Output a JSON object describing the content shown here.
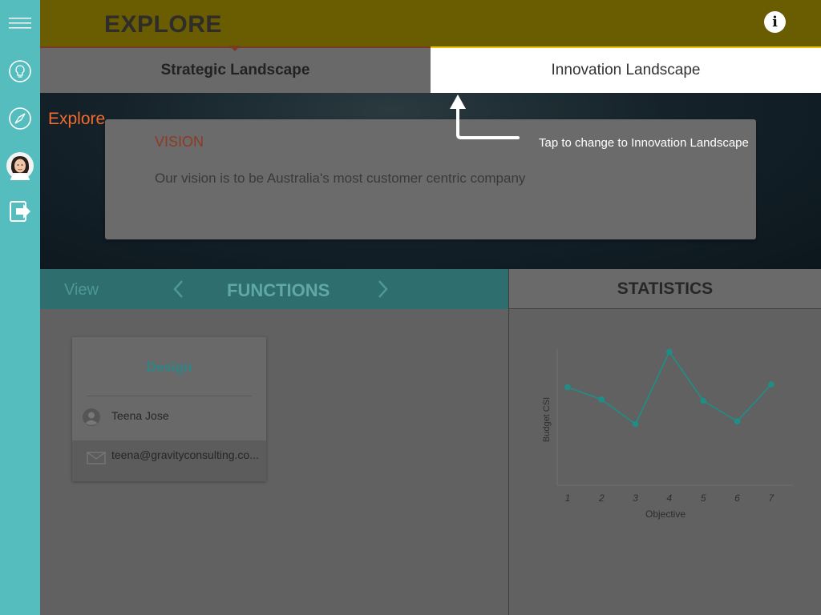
{
  "header": {
    "title": "EXPLORE",
    "info_icon": "info-icon"
  },
  "sidebar": {
    "items": [
      {
        "icon": "menu-icon"
      },
      {
        "icon": "lightbulb-icon"
      },
      {
        "icon": "compass-icon"
      },
      {
        "icon": "avatar"
      },
      {
        "icon": "logout-icon"
      }
    ]
  },
  "tabs": [
    {
      "label": "Strategic Landscape",
      "selected": true
    },
    {
      "label": "Innovation Landscape",
      "selected": false
    }
  ],
  "hero": {
    "explore_label": "Explore",
    "vision_heading": "VISION",
    "vision_text": "Our vision is to be Australia's most customer centric company",
    "hint": "Tap to change to Innovation Landscape"
  },
  "functions": {
    "view_label": "View",
    "title": "FUNCTIONS",
    "card": {
      "role": "Design",
      "name": "Teena Jose",
      "email": "teena@gravityconsulting.co..."
    }
  },
  "statistics": {
    "title": "STATISTICS"
  },
  "colors": {
    "teal": "#55bdbe",
    "header": "#6a5c00",
    "accent_orange": "#ef6b2f",
    "series": "#1e8f86"
  },
  "chart_data": {
    "type": "line",
    "x": [
      1,
      2,
      3,
      4,
      5,
      6,
      7
    ],
    "values": [
      7.2,
      6.3,
      4.5,
      9.8,
      6.2,
      4.7,
      7.4
    ],
    "xlabel": "Objective",
    "ylabel": "Budget CSI",
    "ylim": [
      0,
      10
    ]
  }
}
